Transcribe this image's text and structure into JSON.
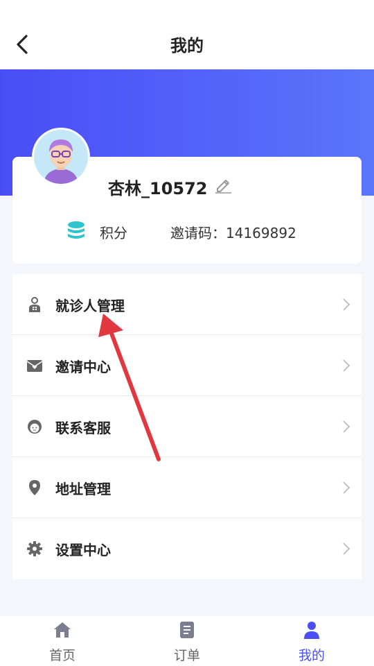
{
  "header": {
    "title": "我的"
  },
  "profile": {
    "username": "杏林_10572",
    "points_label": "积分",
    "invite_code": "邀请码：14169892"
  },
  "menu": {
    "items": [
      {
        "label": "就诊人管理",
        "icon": "patient-icon"
      },
      {
        "label": "邀请中心",
        "icon": "invite-envelope-icon"
      },
      {
        "label": "联系客服",
        "icon": "customer-service-icon"
      },
      {
        "label": "地址管理",
        "icon": "location-pin-icon"
      },
      {
        "label": "设置中心",
        "icon": "gear-icon"
      }
    ]
  },
  "tabbar": {
    "tabs": [
      {
        "label": "首页",
        "icon": "home-icon"
      },
      {
        "label": "订单",
        "icon": "order-icon"
      },
      {
        "label": "我的",
        "icon": "user-icon",
        "active": true
      }
    ]
  },
  "colors": {
    "accent": "#4a50f5",
    "hero_start": "#4a4df6",
    "hero_end": "#5a75fb",
    "points_icon": "#2ec4c9",
    "annotation_arrow": "#e0383e"
  }
}
